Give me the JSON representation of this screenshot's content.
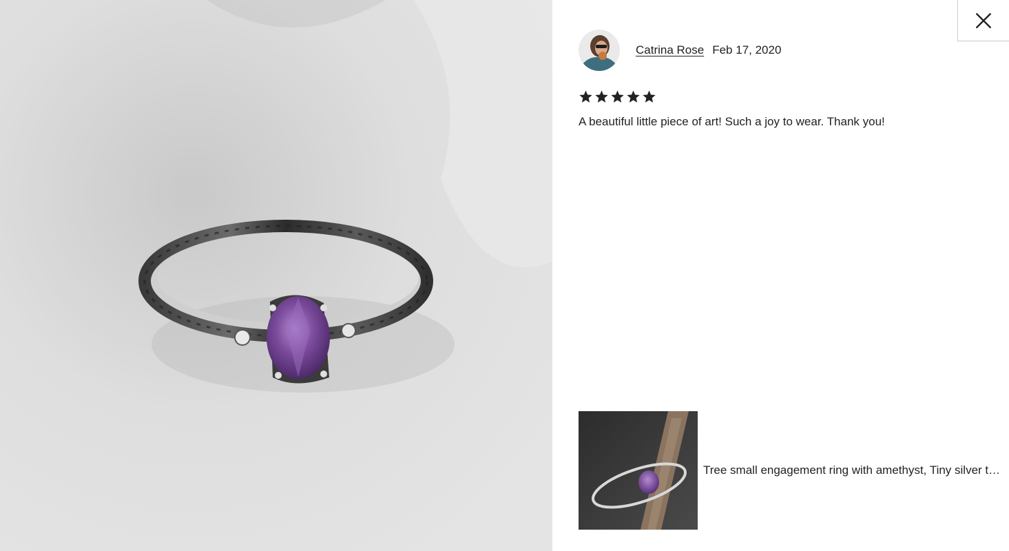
{
  "review_modal": {
    "photo": {
      "icon": "ring-photo",
      "description_icon": "amethyst-ring-image"
    },
    "close": {
      "icon": "close-icon"
    },
    "reviewer": {
      "name": "Catrina Rose",
      "date": "Feb 17, 2020",
      "avatar_icon": "avatar"
    },
    "rating": {
      "stars": 5,
      "max": 5,
      "star_color": "#222222"
    },
    "review_text": "A beautiful little piece of art! Such a joy to wear. Thank you!",
    "listing": {
      "title": "Tree small engagement ring with amethyst, Tiny silver twig ring",
      "thumb_icon": "listing-thumbnail"
    }
  },
  "colors": {
    "text": "#222222",
    "border": "#cccccc",
    "amethyst": "#7b4b9c"
  }
}
